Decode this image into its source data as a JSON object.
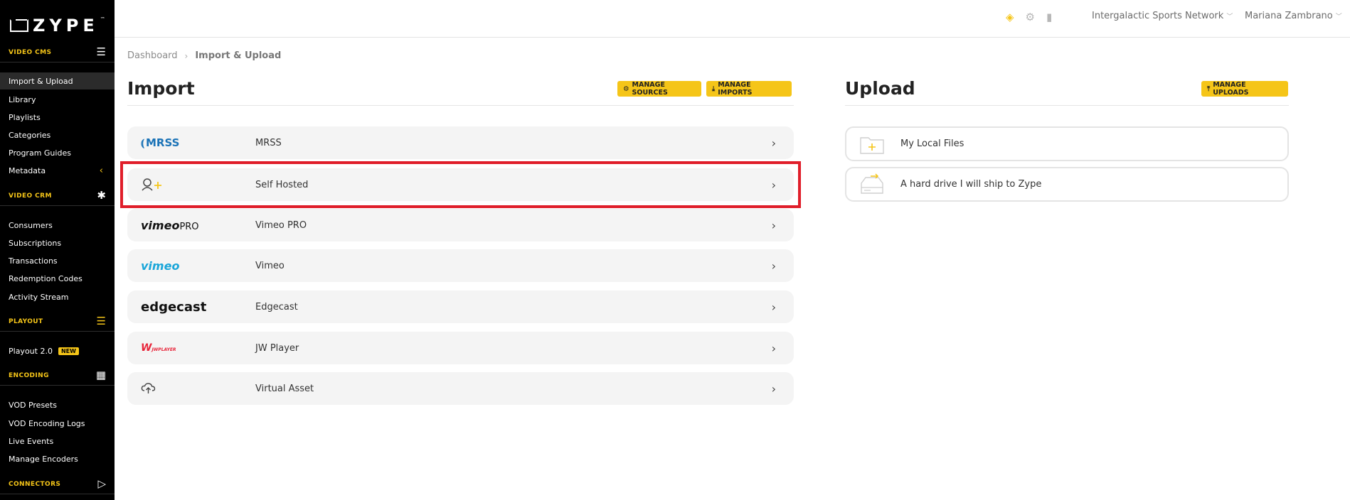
{
  "brand": {
    "logo_text": "ZYPE",
    "tm": "™"
  },
  "sidebar": {
    "sections": [
      {
        "label": "VIDEO CMS",
        "icon": "menu-icon",
        "items": [
          {
            "label": "Import & Upload"
          },
          {
            "label": "Library"
          },
          {
            "label": "Playlists"
          },
          {
            "label": "Categories"
          },
          {
            "label": "Program Guides"
          },
          {
            "label": "Metadata"
          }
        ]
      },
      {
        "label": "VIDEO CRM",
        "icon": "asterisk-icon",
        "items": [
          {
            "label": "Consumers"
          },
          {
            "label": "Subscriptions"
          },
          {
            "label": "Transactions"
          },
          {
            "label": "Redemption Codes"
          },
          {
            "label": "Activity Stream"
          }
        ]
      },
      {
        "label": "PLAYOUT",
        "icon": "playout-icon",
        "items": [
          {
            "label": "Playout 2.0",
            "badge": "NEW"
          }
        ]
      },
      {
        "label": "ENCODING",
        "icon": "grid-icon",
        "items": [
          {
            "label": "VOD Presets"
          },
          {
            "label": "VOD Encoding Logs"
          },
          {
            "label": "Live Events"
          },
          {
            "label": "Manage Encoders"
          }
        ]
      },
      {
        "label": "CONNECTORS",
        "icon": "play-outline-icon",
        "items": []
      }
    ]
  },
  "topbar": {
    "organization": "Intergalactic Sports Network",
    "user": "Mariana Zambrano"
  },
  "breadcrumb": {
    "home": "Dashboard",
    "current": "Import & Upload"
  },
  "import": {
    "title": "Import",
    "manage_sources": "MANAGE SOURCES",
    "manage_imports": "MANAGE IMPORTS",
    "rows": [
      {
        "logo": "MRSS",
        "label": "MRSS"
      },
      {
        "logo": "",
        "label": "Self Hosted"
      },
      {
        "logo": "vimeo",
        "logo_suffix": "PRO",
        "label": "Vimeo PRO"
      },
      {
        "logo": "vimeo",
        "label": "Vimeo"
      },
      {
        "logo": "edgecast",
        "label": "Edgecast"
      },
      {
        "logo": "W",
        "logo_suffix": "JWPLAYER",
        "label": "JW Player"
      },
      {
        "logo": "",
        "label": "Virtual Asset"
      }
    ]
  },
  "upload": {
    "title": "Upload",
    "manage_uploads": "MANAGE UPLOADS",
    "cards": [
      {
        "label": "My Local Files"
      },
      {
        "label": "A hard drive I will ship to Zype"
      }
    ]
  },
  "colors": {
    "accent": "#f5c518",
    "highlight": "#e01e2a",
    "sidebar": "#000000"
  }
}
